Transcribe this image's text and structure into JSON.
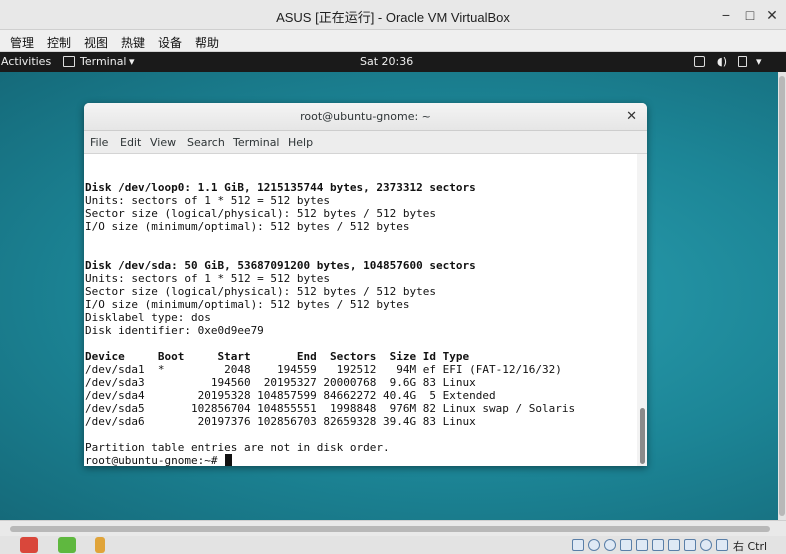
{
  "host_window": {
    "title": "ASUS [正在运行] - Oracle VM VirtualBox",
    "controls": {
      "minimize": "−",
      "maximize": "□",
      "close": "✕"
    },
    "menu": [
      "管理",
      "控制",
      "视图",
      "热键",
      "设备",
      "帮助"
    ]
  },
  "gnome_topbar": {
    "activities": "Activities",
    "app_menu": "Terminal",
    "app_menu_arrow": "▾",
    "clock": "Sat 20:36",
    "power_arrow": "▾"
  },
  "terminal": {
    "title": "root@ubuntu-gnome: ~",
    "close": "✕",
    "menu": [
      "File",
      "Edit",
      "View",
      "Search",
      "Terminal",
      "Help"
    ],
    "lines": [
      "Disk /dev/loop0: 1.1 GiB, 1215135744 bytes, 2373312 sectors",
      "Units: sectors of 1 * 512 = 512 bytes",
      "Sector size (logical/physical): 512 bytes / 512 bytes",
      "I/O size (minimum/optimal): 512 bytes / 512 bytes",
      "",
      "",
      "Disk /dev/sda: 50 GiB, 53687091200 bytes, 104857600 sectors",
      "Units: sectors of 1 * 512 = 512 bytes",
      "Sector size (logical/physical): 512 bytes / 512 bytes",
      "I/O size (minimum/optimal): 512 bytes / 512 bytes",
      "Disklabel type: dos",
      "Disk identifier: 0xe0d9ee79",
      "",
      "Device     Boot     Start       End  Sectors  Size Id Type",
      "/dev/sda1  *         2048    194559   192512   94M ef EFI (FAT-12/16/32)",
      "/dev/sda3          194560  20195327 20000768  9.6G 83 Linux",
      "/dev/sda4        20195328 104857599 84662272 40.4G  5 Extended",
      "/dev/sda5       102856704 104855551  1998848  976M 82 Linux swap / Solaris",
      "/dev/sda6        20197376 102856703 82659328 39.4G 83 Linux",
      "",
      "Partition table entries are not in disk order.",
      "root@ubuntu-gnome:~# "
    ]
  },
  "statusbar": {
    "host_key": "右 Ctrl"
  }
}
